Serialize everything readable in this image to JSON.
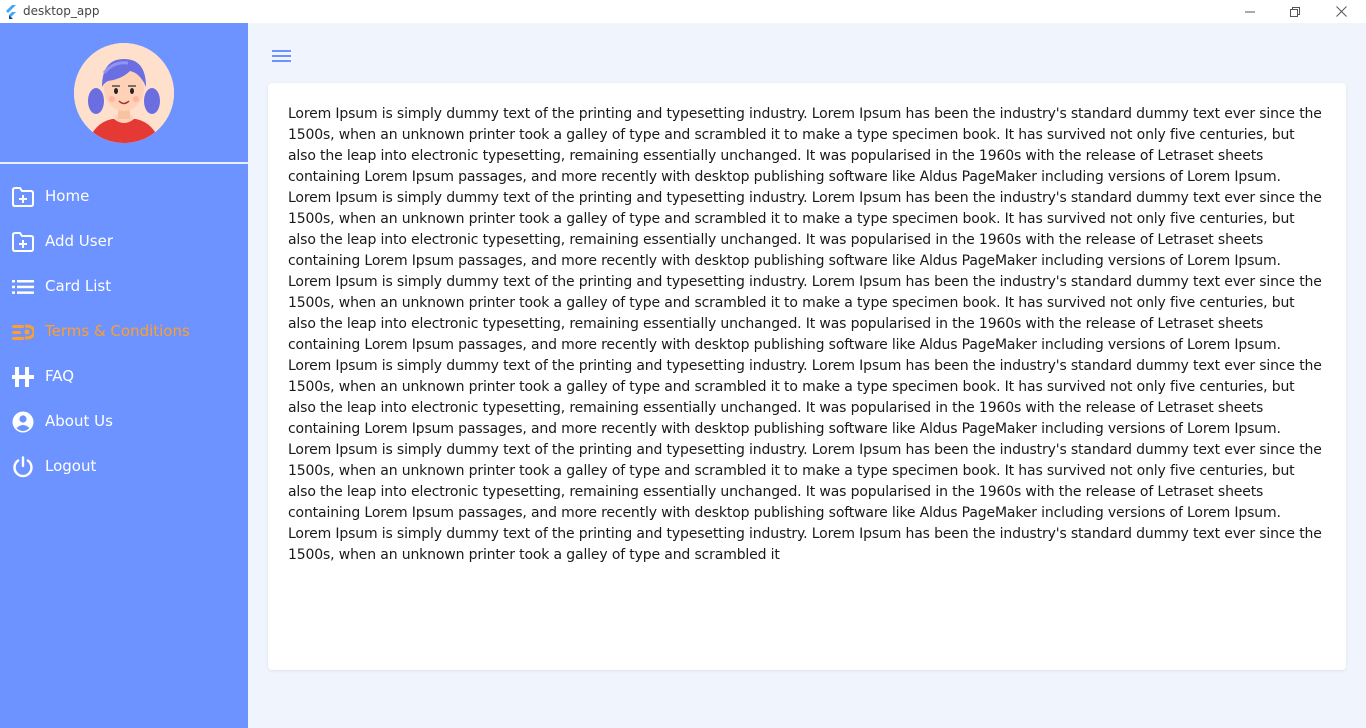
{
  "window": {
    "title": "desktop_app"
  },
  "sidebar": {
    "items": [
      {
        "label": "Home",
        "icon": "folder-plus-icon",
        "active": false
      },
      {
        "label": "Add User",
        "icon": "folder-plus-icon",
        "active": false
      },
      {
        "label": "Card List",
        "icon": "list-icon",
        "active": false
      },
      {
        "label": "Terms & Conditions",
        "icon": "terms-icon",
        "active": true
      },
      {
        "label": "FAQ",
        "icon": "faq-icon",
        "active": false
      },
      {
        "label": "About Us",
        "icon": "account-circle-icon",
        "active": false
      },
      {
        "label": "Logout",
        "icon": "power-icon",
        "active": false
      }
    ]
  },
  "main": {
    "content": "Lorem Ipsum is simply dummy text of the printing and typesetting industry. Lorem Ipsum has been the industry's standard dummy text ever since the 1500s, when an unknown printer took a galley of type and scrambled it to make a type specimen book. It has survived not only five centuries, but also the leap into electronic typesetting, remaining essentially unchanged. It was popularised in the 1960s with the release of Letraset sheets containing Lorem Ipsum passages, and more recently with desktop publishing software like Aldus PageMaker including versions of Lorem Ipsum. Lorem Ipsum is simply dummy text of the printing and typesetting industry. Lorem Ipsum has been the industry's standard dummy text ever since the 1500s, when an unknown printer took a galley of type and scrambled it to make a type specimen book. It has survived not only five centuries, but also the leap into electronic typesetting, remaining essentially unchanged. It was popularised in the 1960s with the release of Letraset sheets containing Lorem Ipsum passages, and more recently with desktop publishing software like Aldus PageMaker including versions of Lorem Ipsum. Lorem Ipsum is simply dummy text of the printing and typesetting industry. Lorem Ipsum has been the industry's standard dummy text ever since the 1500s, when an unknown printer took a galley of type and scrambled it to make a type specimen book. It has survived not only five centuries, but also the leap into electronic typesetting, remaining essentially unchanged. It was popularised in the 1960s with the release of Letraset sheets containing Lorem Ipsum passages, and more recently with desktop publishing software like Aldus PageMaker including versions of Lorem Ipsum. Lorem Ipsum is simply dummy text of the printing and typesetting industry. Lorem Ipsum has been the industry's standard dummy text ever since the 1500s, when an unknown printer took a galley of type and scrambled it to make a type specimen book. It has survived not only five centuries, but also the leap into electronic typesetting, remaining essentially unchanged. It was popularised in the 1960s with the release of Letraset sheets containing Lorem Ipsum passages, and more recently with desktop publishing software like Aldus PageMaker including versions of Lorem Ipsum. Lorem Ipsum is simply dummy text of the printing and typesetting industry. Lorem Ipsum has been the industry's standard dummy text ever since the 1500s, when an unknown printer took a galley of type and scrambled it to make a type specimen book. It has survived not only five centuries, but also the leap into electronic typesetting, remaining essentially unchanged. It was popularised in the 1960s with the release of Letraset sheets containing Lorem Ipsum passages, and more recently with desktop publishing software like Aldus PageMaker including versions of Lorem Ipsum. Lorem Ipsum is simply dummy text of the printing and typesetting industry. Lorem Ipsum has been the industry's standard dummy text ever since the 1500s, when an unknown printer took a galley of type and scrambled it"
  },
  "colors": {
    "sidebar_bg": "#6c93ff",
    "active_item": "#ff9f29",
    "main_bg": "#f0f5fd",
    "card_bg": "#ffffff",
    "menu_icon": "#6c93ff"
  }
}
